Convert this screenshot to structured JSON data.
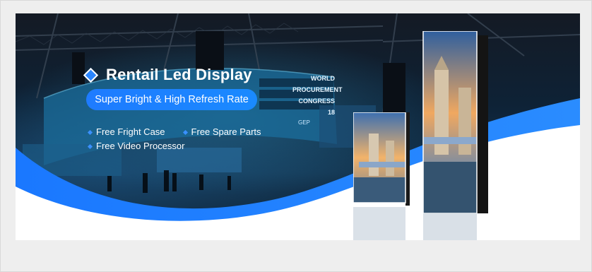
{
  "banner": {
    "title": "Rentail Led Display",
    "subtitle": "Super Bright & High Refresh Rate",
    "features": [
      "Free Fright Case",
      "Free Spare Parts",
      "Free Video Processor"
    ],
    "screen_text": [
      "WORLD",
      "PROCUREMENT",
      "CONGRESS 18",
      "GEP"
    ],
    "colors": {
      "accent": "#1e7bff",
      "wave": "#2a8cff",
      "background": "#eeeeee"
    }
  }
}
